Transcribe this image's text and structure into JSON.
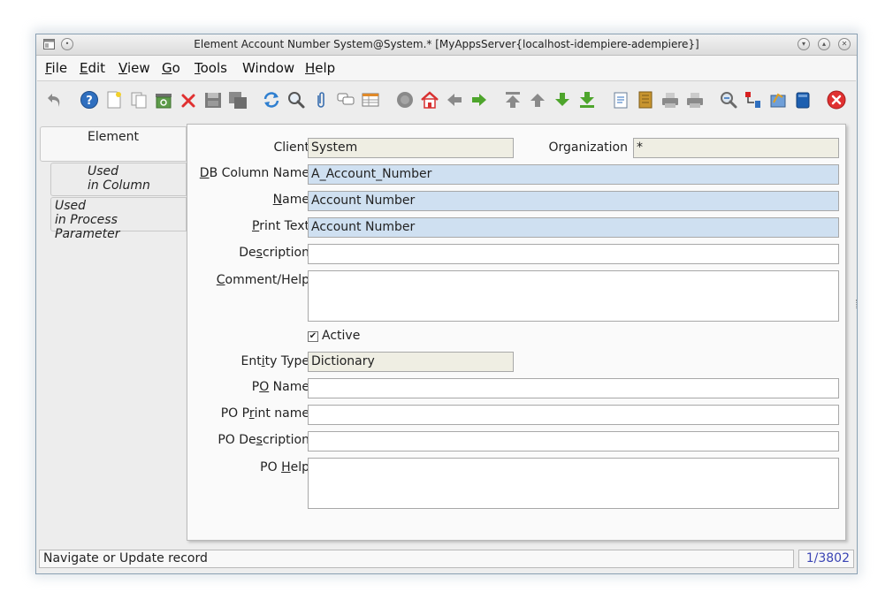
{
  "window": {
    "title": "Element  Account Number  System@System.* [MyAppsServer{localhost-idempiere-adempiere}]"
  },
  "menu": [
    {
      "label": "File",
      "ul": "F"
    },
    {
      "label": "Edit",
      "ul": "E"
    },
    {
      "label": "View",
      "ul": "V"
    },
    {
      "label": "Go",
      "ul": "G"
    },
    {
      "label": "Tools",
      "ul": "T"
    },
    {
      "label": "Window",
      "ul": ""
    },
    {
      "label": "Help",
      "ul": "H"
    }
  ],
  "toolbar": {
    "icons": [
      "undo-icon",
      "help-icon",
      "new-record-icon",
      "copy-record-icon",
      "archive-icon",
      "delete-icon",
      "save-icon",
      "save-multi-icon",
      "refresh-icon",
      "find-icon",
      "attachment-icon",
      "chat-icon",
      "grid-toggle-icon",
      "history-icon",
      "home-icon",
      "parent-record-icon",
      "detail-record-icon",
      "first-record-icon",
      "previous-record-icon",
      "next-record-icon",
      "last-record-icon",
      "report-icon",
      "archived-docs-icon",
      "print-preview-icon",
      "print-icon",
      "zoom-across-icon",
      "workflow-icon",
      "request-icon",
      "product-info-icon",
      "end-window-icon"
    ]
  },
  "tabs": [
    {
      "lines": [
        "Element"
      ]
    },
    {
      "lines": [
        "Used",
        "in Column"
      ]
    },
    {
      "lines": [
        "Used",
        "in Process Parameter"
      ]
    }
  ],
  "form": {
    "client_label": "Client",
    "client_value": "System",
    "org_label": "Organization",
    "org_value": "*",
    "db_column_label": "DB Column Name",
    "db_column_value": "A_Account_Number",
    "name_label": "Name",
    "name_value": "Account Number",
    "print_text_label": "Print Text",
    "print_text_value": "Account Number",
    "description_label": "Description",
    "description_value": "",
    "comment_label": "Comment/Help",
    "comment_value": "",
    "active_label": "Active",
    "active_checked": true,
    "entity_type_label": "Entity Type",
    "entity_type_value": "Dictionary",
    "po_name_label": "PO Name",
    "po_name_value": "",
    "po_print_label": "PO Print name",
    "po_print_value": "",
    "po_description_label": "PO Description",
    "po_description_value": "",
    "po_help_label": "PO Help",
    "po_help_value": ""
  },
  "status": {
    "message": "Navigate or Update record",
    "record": "1/3802"
  },
  "colors": {
    "mandatory": "#cfe0f1",
    "readonly": "#efeee3",
    "record_counter": "#3a44b4",
    "delete_red": "#e03030",
    "nav_green": "#4ea52c"
  }
}
